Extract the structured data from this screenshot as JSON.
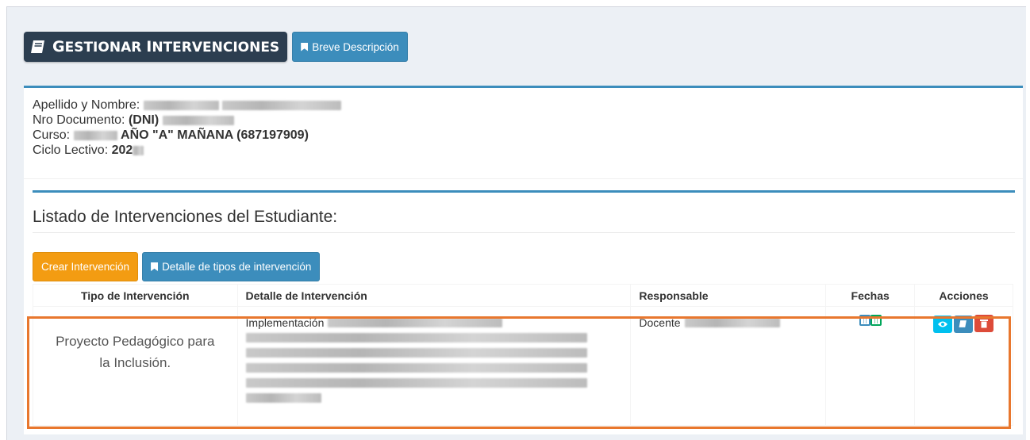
{
  "header": {
    "title_first": "G",
    "title_rest_1": "ESTIONAR ",
    "title_second": "I",
    "title_rest_2": "NTERVENCIONES",
    "brief_button": "Breve Descripción"
  },
  "student": {
    "name_label": "Apellido y Nombre:",
    "doc_label": "Nro Documento:",
    "doc_type": "(DNI)",
    "course_label": "Curso:",
    "course_value": "AÑO \"A\" MAÑANA (687197909)",
    "cycle_label": "Ciclo Lectivo:",
    "cycle_value": "202"
  },
  "list": {
    "title": "Listado de Intervenciones del Estudiante:",
    "create_button": "Crear Intervención",
    "detail_button": "Detalle de tipos de intervención",
    "columns": [
      "Tipo de Intervención",
      "Detalle de Intervención",
      "Responsable",
      "Fechas",
      "Acciones"
    ],
    "rows": [
      {
        "tipo_line1": "Proyecto Pedagógico para",
        "tipo_line2": "la Inclusión.",
        "detalle_start": "Implementación",
        "responsable": "Docente"
      }
    ]
  },
  "icons": {
    "title": "book-icon",
    "bookmark": "bookmark-icon",
    "calendar": "calendar-icon",
    "view": "eye-icon",
    "edit": "book-icon",
    "delete": "trash-icon"
  },
  "colors": {
    "primary": "#3c8dbc",
    "warning": "#f39c12",
    "dark": "#2c3e50",
    "info": "#00c0ef",
    "danger": "#dd4b39",
    "highlight": "#e8772e"
  }
}
